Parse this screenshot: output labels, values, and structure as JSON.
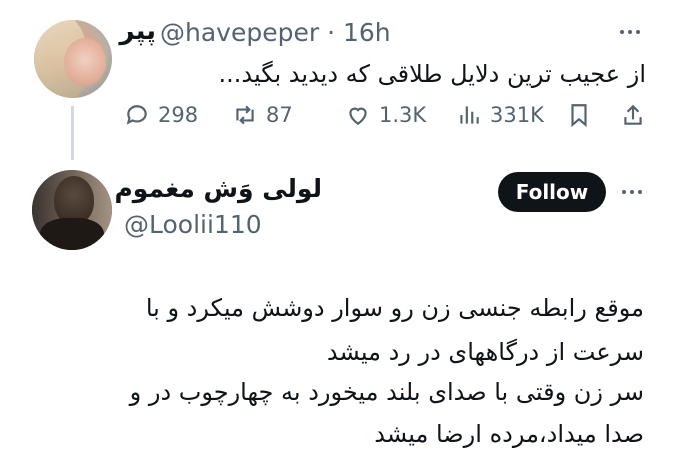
{
  "parent_tweet": {
    "display_name": "پپر",
    "handle": "@havepeper",
    "separator": "·",
    "time": "16h",
    "text": "از عجیب ترین دلایل طلاقی که دیدید بگید...",
    "stats": {
      "replies": "298",
      "retweets": "87",
      "likes": "1.3K",
      "views": "331K"
    }
  },
  "reply_tweet": {
    "display_name": "لولی وَش مغموم",
    "handle": "@Loolii110",
    "follow_label": "Follow",
    "lines": [
      "موقع رابطه جنسی زن رو سوار دوشش میکرد و با",
      "سرعت از درگاههای در رد میشد",
      "سر زن وقتی با صدای بلند میخورد به چهارچوب در و",
      "صدا میداد،مرده ارضا میشد"
    ]
  },
  "icons": {
    "reply": "reply-icon",
    "retweet": "retweet-icon",
    "like": "heart-icon",
    "views": "views-icon",
    "bookmark": "bookmark-icon",
    "share": "share-icon",
    "more": "more-icon"
  }
}
